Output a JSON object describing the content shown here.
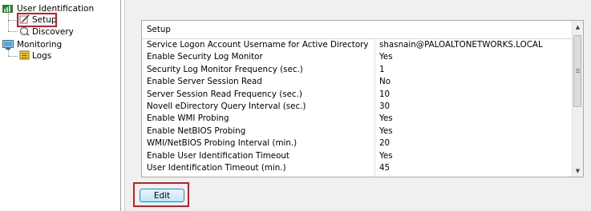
{
  "tree": {
    "user_identification": "User Identification",
    "setup": "Setup",
    "discovery": "Discovery",
    "monitoring": "Monitoring",
    "logs": "Logs"
  },
  "table": {
    "header": "Setup",
    "rows": [
      {
        "label": "Service Logon Account Username for Active Directory",
        "value": "shasnain@PALOALTONETWORKS.LOCAL"
      },
      {
        "label": "Enable Security Log Monitor",
        "value": "Yes"
      },
      {
        "label": "Security Log Monitor Frequency (sec.)",
        "value": "1"
      },
      {
        "label": "Enable Server Session Read",
        "value": "No"
      },
      {
        "label": "Server Session Read Frequency (sec.)",
        "value": "10"
      },
      {
        "label": "Novell eDirectory Query Interval (sec.)",
        "value": "30"
      },
      {
        "label": "Enable WMI Probing",
        "value": "Yes"
      },
      {
        "label": "Enable NetBIOS Probing",
        "value": "Yes"
      },
      {
        "label": "WMI/NetBIOS Probing Interval (min.)",
        "value": "20"
      },
      {
        "label": "Enable User Identification Timeout",
        "value": "Yes"
      },
      {
        "label": "User Identification Timeout (min.)",
        "value": "45"
      }
    ]
  },
  "edit_button": "Edit",
  "colors": {
    "highlight_box": "#c0202a",
    "button_border": "#3c7fb1"
  }
}
